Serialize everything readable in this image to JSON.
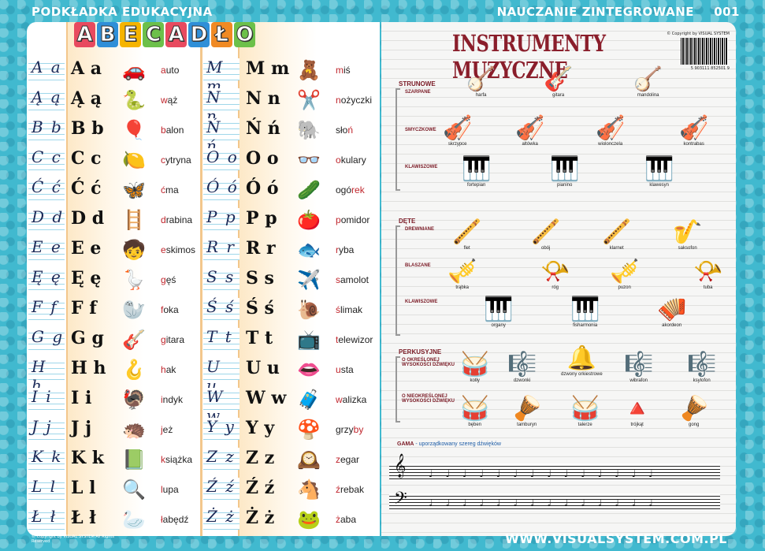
{
  "header": {
    "left_title": "PODKŁADKA EDUKACYJNA",
    "right_title": "NAUCZANIE ZINTEGROWANE",
    "number": "001"
  },
  "footer": {
    "website": "WWW.VISUALSYSTEM.COM.PL",
    "copyright_small": "© Copyright by VISUAL SYSTEM All Rights Reserved"
  },
  "alphabet": {
    "title_letters": [
      "A",
      "B",
      "E",
      "C",
      "A",
      "D",
      "Ł",
      "O"
    ],
    "title_colors": [
      "#e84a5f",
      "#2f8fd8",
      "#f5b400",
      "#6cc04a",
      "#e84a5f",
      "#2f8fd8",
      "#f08a24",
      "#6cc04a"
    ],
    "left_column": [
      {
        "hand": "A a",
        "print": "A a",
        "icon": "🚗",
        "first": "a",
        "rest": "uto"
      },
      {
        "hand": "Ą ą",
        "print": "Ą ą",
        "icon": "🐍",
        "first": "w",
        "rest": "ąż"
      },
      {
        "hand": "B b",
        "print": "B b",
        "icon": "🎈",
        "first": "b",
        "rest": "alon"
      },
      {
        "hand": "C c",
        "print": "C c",
        "icon": "🍋",
        "first": "c",
        "rest": "ytryna"
      },
      {
        "hand": "Ć ć",
        "print": "Ć ć",
        "icon": "🦋",
        "first": "ć",
        "rest": "ma"
      },
      {
        "hand": "D d",
        "print": "D d",
        "icon": "🪜",
        "first": "d",
        "rest": "rabina"
      },
      {
        "hand": "E e",
        "print": "E e",
        "icon": "🧒",
        "first": "e",
        "rest": "skimos"
      },
      {
        "hand": "Ę ę",
        "print": "Ę ę",
        "icon": "🪿",
        "first": "g",
        "rest": "ęś"
      },
      {
        "hand": "F f",
        "print": "F f",
        "icon": "🦭",
        "first": "f",
        "rest": "oka"
      },
      {
        "hand": "G g",
        "print": "G g",
        "icon": "🎸",
        "first": "g",
        "rest": "itara"
      },
      {
        "hand": "H h",
        "print": "H h",
        "icon": "🪝",
        "first": "h",
        "rest": "ak"
      },
      {
        "hand": "I i",
        "print": "I i",
        "icon": "🦃",
        "first": "i",
        "rest": "ndyk"
      },
      {
        "hand": "J j",
        "print": "J j",
        "icon": "🦔",
        "first": "j",
        "rest": "eż"
      },
      {
        "hand": "K k",
        "print": "K k",
        "icon": "📗",
        "first": "k",
        "rest": "siążka"
      },
      {
        "hand": "L l",
        "print": "L l",
        "icon": "🔍",
        "first": "l",
        "rest": "upa"
      },
      {
        "hand": "Ł ł",
        "print": "Ł ł",
        "icon": "🦢",
        "first": "ł",
        "rest": "abędź"
      }
    ],
    "right_column": [
      {
        "hand": "M m",
        "print": "M m",
        "icon": "🧸",
        "first": "m",
        "rest": "iś"
      },
      {
        "hand": "N n",
        "print": "N n",
        "icon": "✂️",
        "first": "n",
        "rest": "ożyczki"
      },
      {
        "hand": "Ń ń",
        "print": "Ń ń",
        "icon": "🐘",
        "first": "sło",
        "rest": "ń",
        "suffix": true
      },
      {
        "hand": "O o",
        "print": "O o",
        "icon": "👓",
        "first": "o",
        "rest": "kulary"
      },
      {
        "hand": "Ó ó",
        "print": "Ó ó",
        "icon": "🥒",
        "first": "ogó",
        "rest": "rek",
        "mid": true
      },
      {
        "hand": "P p",
        "print": "P p",
        "icon": "🍅",
        "first": "p",
        "rest": "omidor"
      },
      {
        "hand": "R r",
        "print": "R r",
        "icon": "🐟",
        "first": "r",
        "rest": "yba"
      },
      {
        "hand": "S s",
        "print": "S s",
        "icon": "✈️",
        "first": "s",
        "rest": "amolot"
      },
      {
        "hand": "Ś ś",
        "print": "Ś ś",
        "icon": "🐌",
        "first": "ś",
        "rest": "limak"
      },
      {
        "hand": "T t",
        "print": "T t",
        "icon": "📺",
        "first": "t",
        "rest": "elewizor"
      },
      {
        "hand": "U u",
        "print": "U u",
        "icon": "👄",
        "first": "u",
        "rest": "sta"
      },
      {
        "hand": "W w",
        "print": "W w",
        "icon": "🧳",
        "first": "w",
        "rest": "alizka"
      },
      {
        "hand": "Y y",
        "print": "Y y",
        "icon": "🍄",
        "first": "grzy",
        "rest": "by",
        "ymid": true
      },
      {
        "hand": "Z z",
        "print": "Z z",
        "icon": "🕰️",
        "first": "z",
        "rest": "egar"
      },
      {
        "hand": "Ź ź",
        "print": "Ź ź",
        "icon": "🐴",
        "first": "ź",
        "rest": "rebak"
      },
      {
        "hand": "Ż ż",
        "print": "Ż ż",
        "icon": "🐸",
        "first": "ż",
        "rest": "aba"
      }
    ]
  },
  "instruments": {
    "title": "INSTRUMENTY MUZYCZNE",
    "copyright": "© Copyright by VISUAL SYSTEM",
    "barcode_number": "5 903111 852501 9",
    "sections": {
      "strunowe": "STRUNOWE",
      "szarpane": "SZARPANE",
      "smyczkowe": "SMYCZKOWE",
      "klawiszowe1": "KLAWISZOWE",
      "dete": "DĘTE",
      "drewniane": "DREWNIANE",
      "blaszane": "BLASZANE",
      "klawiszowe2": "KLAWISZOWE",
      "perkusyjne": "PERKUSYJNE",
      "okreslonej": "O OKREŚLONEJ WYSOKOŚCI DŹWIĘKU",
      "nieokreslonej": "O NIEOKREŚLONEJ WYSOKOŚCI DŹWIĘKU"
    },
    "items": {
      "harfa": "harfa",
      "gitara": "gitara",
      "mandolina": "mandolina",
      "skrzypce": "skrzypce",
      "altowka": "altówka",
      "wiolonczela": "wiolonczela",
      "kontrabas": "kontrabas",
      "fortepian": "fortepian",
      "pianino": "pianino",
      "klawesyn": "klawesyn",
      "flet": "flet",
      "obój": "obój",
      "klarnet": "klarnet",
      "saksofon": "saksofon",
      "trabka": "trąbka",
      "rog": "róg",
      "puzon": "puzon",
      "tuba": "tuba",
      "organy": "organy",
      "fisharmonia": "fisharmonia",
      "akordeon": "akordeon",
      "kotly": "kotły",
      "dzwonki": "dzwonki",
      "dzwony": "dzwony orkiestrowe",
      "wibrafon": "wibrafon",
      "ksylofon": "ksylofon",
      "beben": "bęben",
      "tamburyn": "tamburyn",
      "talerze": "talerze",
      "trojkat": "trójkąt",
      "gong": "gong"
    },
    "gama_label": "GAMA",
    "gama_text": " - uporządkowany szereg dźwięków"
  }
}
